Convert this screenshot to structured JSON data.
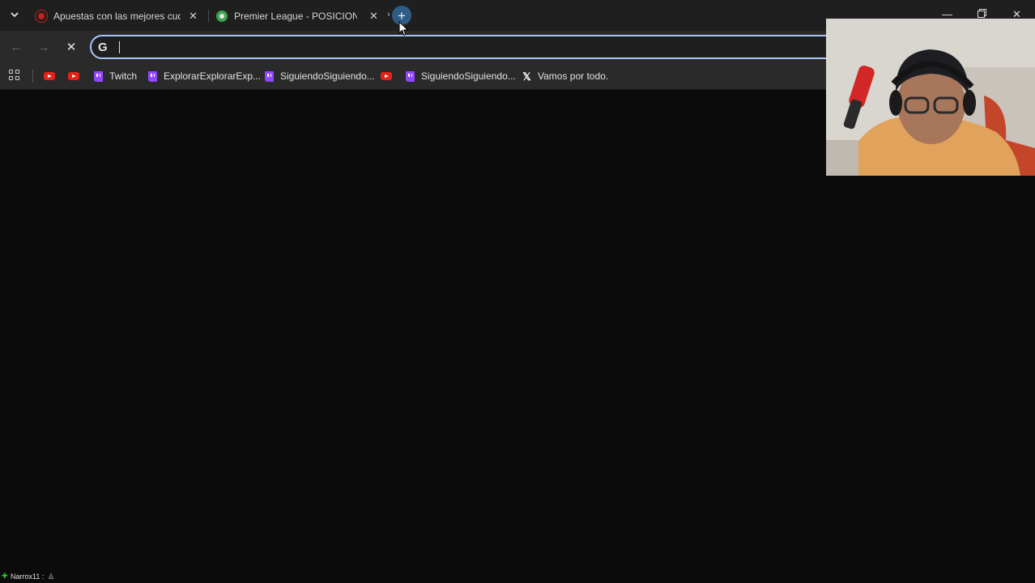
{
  "tabs": [
    {
      "title": "Apuestas con las mejores cuota",
      "favicon": "red-circle-favicon"
    },
    {
      "title": "Premier League - POSICIONES,",
      "favicon": "green-soccer-ball-favicon"
    }
  ],
  "toolbar": {
    "omnibox_value": "",
    "search_engine_icon": "G"
  },
  "bookmarks": [
    {
      "label": "",
      "icon": "youtube-icon"
    },
    {
      "label": "",
      "icon": "youtube-icon"
    },
    {
      "label": "Twitch",
      "icon": "twitch-icon"
    },
    {
      "label": "ExplorarExplorarExp...",
      "icon": "twitch-icon"
    },
    {
      "label": "SiguiendoSiguiendo...",
      "icon": "twitch-icon"
    },
    {
      "label": "",
      "icon": "youtube-icon"
    },
    {
      "label": "SiguiendoSiguiendo...",
      "icon": "twitch-icon"
    },
    {
      "label": "Vamos por todo.",
      "icon": "x-icon"
    }
  ],
  "footer": {
    "user": "Narrox11 :"
  },
  "colors": {
    "accent": "#a8c7fa",
    "newtab_button": "#2f5c84",
    "twitch": "#9146ff",
    "youtube": "#e62117"
  }
}
